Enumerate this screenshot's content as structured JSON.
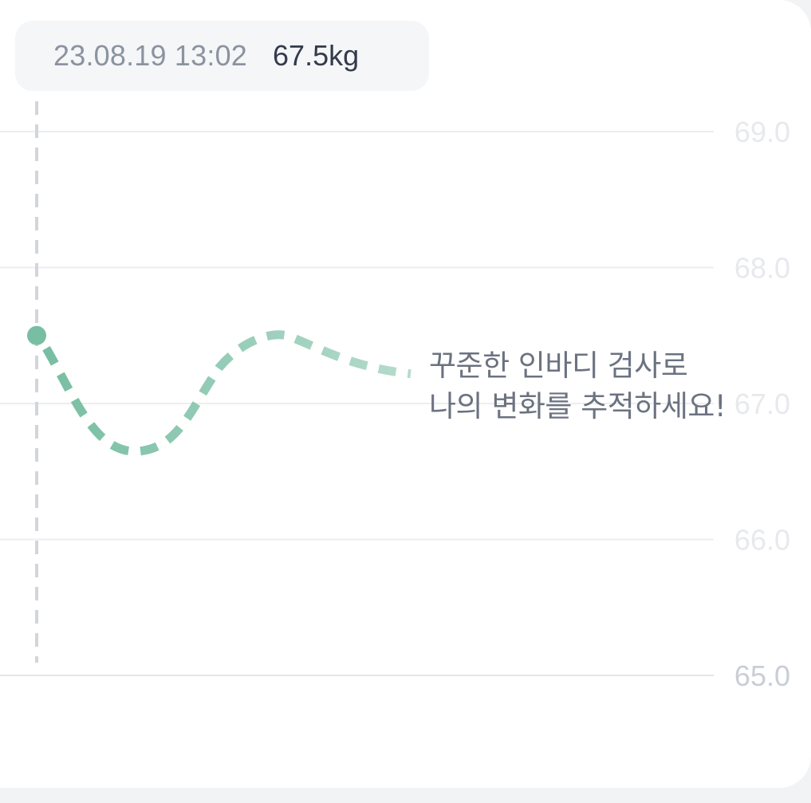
{
  "tooltip": {
    "datetime": "23.08.19 13:02",
    "value": "67.5kg"
  },
  "message": {
    "line1": "꾸준한 인바디 검사로",
    "line2": "나의 변화를 추적하세요!"
  },
  "colors": {
    "accent": "#78bea3",
    "guide": "#d2d5db",
    "grid": "#eceef1"
  },
  "chart_data": {
    "type": "line",
    "ylim": [
      65.0,
      69.0
    ],
    "y_ticks": [
      "69.0",
      "68.0",
      "67.0",
      "66.0",
      "65.0"
    ],
    "series": [
      {
        "values": [
          67.5
        ]
      }
    ],
    "grid": true
  }
}
